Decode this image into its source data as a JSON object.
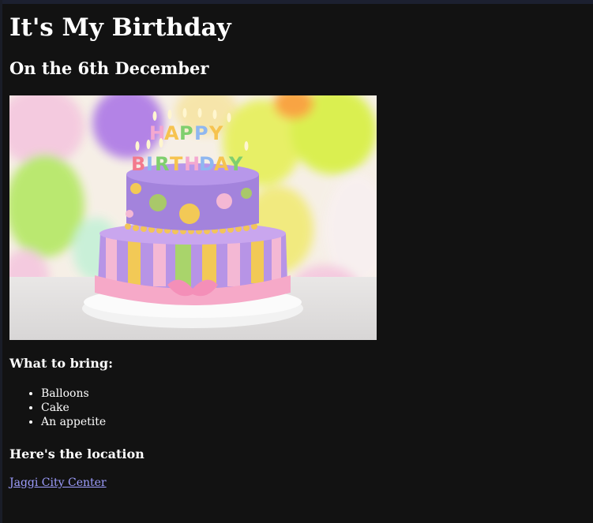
{
  "page": {
    "heading": "It's My Birthday",
    "subheading": "On the 6th December",
    "bring_heading": "What to bring:",
    "bring_items": [
      "Balloons",
      "Cake",
      "An appetite"
    ],
    "location_heading": "Here's the location",
    "location_link": "Jaggi City Center",
    "image_caption": "HAPPY BIRTHDAY"
  },
  "colors": {
    "background": "#121212",
    "text": "#ffffff",
    "link": "#9e9eff"
  }
}
